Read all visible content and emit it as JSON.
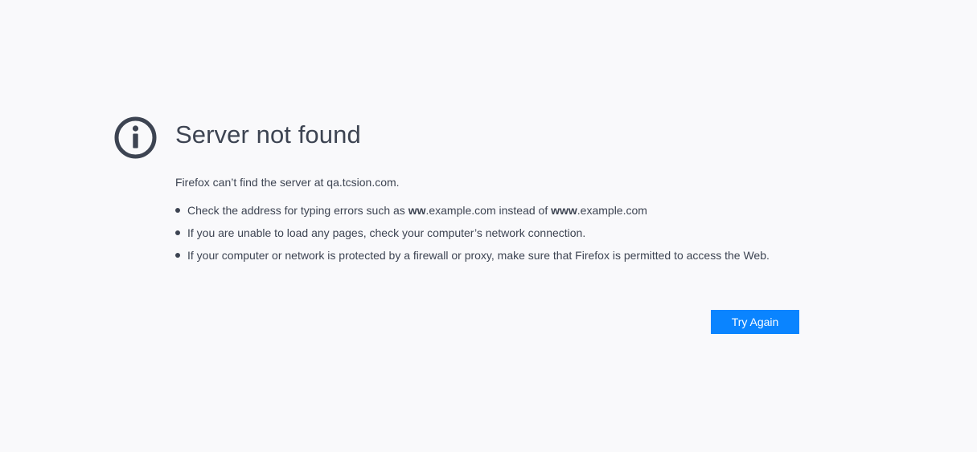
{
  "error": {
    "title": "Server not found",
    "description": "Firefox can’t find the server at qa.tcsion.com.",
    "suggestions": [
      {
        "parts": [
          "Check the address for typing errors such as ",
          "ww",
          ".example.com instead of ",
          "www",
          ".example.com"
        ]
      },
      {
        "text": "If you are unable to load any pages, check your computer’s network connection."
      },
      {
        "text": "If your computer or network is protected by a firewall or proxy, make sure that Firefox is permitted to access the Web."
      }
    ],
    "try_again_label": "Try Again"
  },
  "icon": "info-icon",
  "colors": {
    "background": "#f9f9fb",
    "text": "#3d4452",
    "button": "#0a84ff",
    "button_text": "#ffffff"
  }
}
